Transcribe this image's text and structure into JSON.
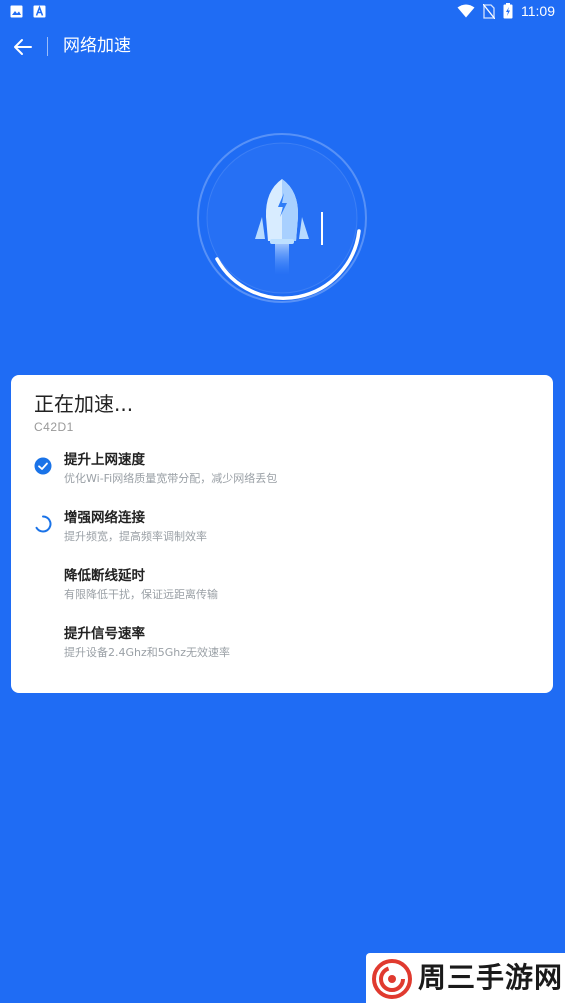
{
  "status_bar": {
    "time": "11:09"
  },
  "header": {
    "title": "网络加速"
  },
  "card": {
    "title": "正在加速...",
    "network_name": "C42D1",
    "tasks": [
      {
        "title": "提升上网速度",
        "desc": "优化Wi-Fi网络质量宽带分配，减少网络丢包",
        "status": "done"
      },
      {
        "title": "增强网络连接",
        "desc": "提升频宽，提高频率调制效率",
        "status": "in-progress"
      },
      {
        "title": "降低断线延时",
        "desc": "有限降低干扰，保证远距离传输",
        "status": "pending"
      },
      {
        "title": "提升信号速率",
        "desc": "提升设备2.4Ghz和5Ghz无效速率",
        "status": "pending"
      }
    ]
  },
  "watermark": {
    "text": "周三手游网"
  },
  "colors": {
    "background": "#1f6cf4",
    "accent": "#1a73e8",
    "card": "#ffffff"
  }
}
